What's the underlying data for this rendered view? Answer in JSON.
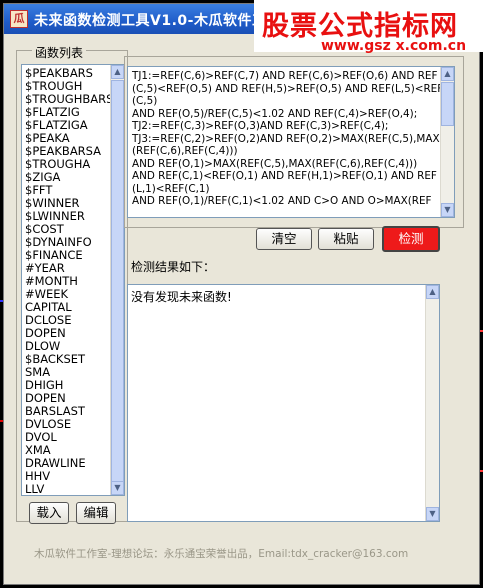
{
  "colors": {
    "titlebar": "#1f5cc9",
    "watermark": "#e81010",
    "detect_button": "#ee1a1a",
    "background": "#000000"
  },
  "window": {
    "title": "未来函数检测工具V1.0-木瓜软件工",
    "icon_char": "瓜"
  },
  "watermark": {
    "title": "股票公式指标网",
    "url": "www.gsz x.com.cn"
  },
  "func_list": {
    "label": "函数列表",
    "items": [
      "$PEAKBARS",
      "$TROUGH",
      "$TROUGHBARS",
      "$FLATZIG",
      "$FLATZIGA",
      "$PEAKA",
      "$PEAKBARSA",
      "$TROUGHA",
      "$ZIGA",
      "$FFT",
      "$WINNER",
      "$LWINNER",
      "$COST",
      "$DYNAINFO",
      "$FINANCE",
      "#YEAR",
      "#MONTH",
      "#WEEK",
      "CAPITAL",
      "DCLOSE",
      "DOPEN",
      "DLOW",
      "$BACKSET",
      "SMA",
      "DHIGH",
      "DOPEN",
      "BARSLAST",
      "DVLOSE",
      "DVOL",
      "XMA",
      "DRAWLINE",
      "HHV",
      "LLV"
    ]
  },
  "code_lines": [
    "TJ1:=REF(C,6)>REF(C,7) AND REF(C,6)>REF(O,6) AND REF",
    "(C,5)<REF(O,5) AND REF(H,5)>REF(O,5) AND REF(L,5)<REF",
    "(C,5)",
    "AND REF(O,5)/REF(C,5)<1.02 AND REF(C,4)>REF(O,4);",
    "TJ2:=REF(C,3)>REF(O,3)AND REF(C,3)>REF(C,4);",
    "TJ3:=REF(C,2)>REF(O,2)AND REF(O,2)>MAX(REF(C,5),MAX",
    "(REF(C,6),REF(C,4)))",
    "AND REF(O,1)>MAX(REF(C,5),MAX(REF(C,6),REF(C,4)))",
    "AND REF(C,1)<REF(O,1) AND REF(H,1)>REF(O,1) AND REF",
    "(L,1)<REF(C,1)",
    "AND REF(O,1)/REF(C,1)<1.02 AND C>O AND O>MAX(REF"
  ],
  "buttons": {
    "clear": "清空",
    "paste": "粘贴",
    "detect": "检测",
    "load": "载入",
    "edit": "编辑"
  },
  "result": {
    "label": "检测结果如下：",
    "text": "没有发现未来函数!"
  },
  "footer": "木瓜软件工作室-理想论坛：永乐通宝荣誉出品，Email:tdx_cracker@163.com"
}
